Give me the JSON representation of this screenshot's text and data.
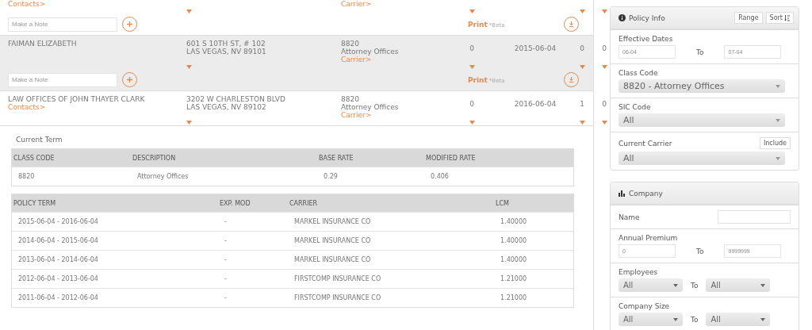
{
  "companies": [
    {
      "contacts": "Contacts>",
      "carrier": "Carrier>",
      "highlighted": false,
      "note": {
        "placeholder": "Make a Note",
        "print": "Print",
        "beta": "*Beta"
      }
    },
    {
      "name": "FAIMAN ELIZABETH",
      "address": [
        "601 S 10TH ST, # 102",
        "LAS VEGAS, NV 89101"
      ],
      "class_code": "8820",
      "class_desc": "Attorney Offices",
      "carrier": "Carrier>",
      "count": "0",
      "date": "2015-06-04",
      "col_a": "0",
      "col_b": "0",
      "highlighted": true,
      "note": {
        "placeholder": "Make a Note",
        "print": "Print",
        "beta": "*Beta"
      }
    },
    {
      "name": "LAW OFFICES OF JOHN THAYER CLARK",
      "contacts": "Contacts>",
      "address": [
        "3202 W CHARLESTON BLVD",
        "LAS VEGAS, NV 89102"
      ],
      "class_code": "8820",
      "class_desc": "Attorney Offices",
      "carrier": "Carrier>",
      "count": "0",
      "date": "2016-06-04",
      "col_a": "1",
      "col_b": "0",
      "highlighted": false,
      "expanded": true
    }
  ],
  "detail": {
    "title": "Current Term",
    "class_table": {
      "columns": [
        "CLASS CODE",
        "DESCRIPTION",
        "BASE RATE",
        "MODIFIED RATE"
      ],
      "rows": [
        [
          "8820",
          "Attorney Offices",
          "0.29",
          "0.406"
        ]
      ]
    },
    "term_table": {
      "columns": [
        "POLICY TERM",
        "EXP. MOD",
        "CARRIER",
        "LCM"
      ],
      "rows": [
        [
          "2015-06-04 - 2016-06-04",
          "-",
          "MARKEL INSURANCE CO",
          "1.40000"
        ],
        [
          "2014-06-04 - 2015-06-04",
          "-",
          "MARKEL INSURANCE CO",
          "1.40000"
        ],
        [
          "2013-06-04 - 2014-06-04",
          "-",
          "MARKEL INSURANCE CO",
          "1.40000"
        ],
        [
          "2012-06-04 - 2013-06-04",
          "-",
          "FIRSTCOMP INSURANCE CO",
          "1.21000"
        ],
        [
          "2011-06-04 - 2012-06-04",
          "-",
          "FIRSTCOMP INSURANCE CO",
          "1.21000"
        ]
      ]
    }
  },
  "sidebar": [
    {
      "title": "Policy Info",
      "buttons": [
        "Range",
        "Sort"
      ],
      "fields": [
        {
          "kind": "range",
          "label": "Effective Dates",
          "from": "06-04",
          "to_label": "To",
          "to": "07-04"
        },
        {
          "kind": "select",
          "label": "Class Code",
          "value": "8820 - Attorney Offices"
        },
        {
          "kind": "select",
          "label": "SIC Code",
          "value": "All"
        },
        {
          "kind": "select",
          "label": "Current Carrier",
          "value": "All",
          "button": "Include"
        }
      ]
    },
    {
      "title": "Company",
      "fields": [
        {
          "kind": "text",
          "label": "Name"
        },
        {
          "kind": "range",
          "label": "Annual Premium",
          "from": "0",
          "to_label": "To",
          "to": "9999999"
        },
        {
          "kind": "select_range",
          "label": "Employees",
          "from": "All",
          "to_label": "To",
          "to": "All"
        },
        {
          "kind": "select_range",
          "label": "Company Size",
          "from": "All",
          "to_label": "To",
          "to": "All"
        }
      ]
    }
  ]
}
